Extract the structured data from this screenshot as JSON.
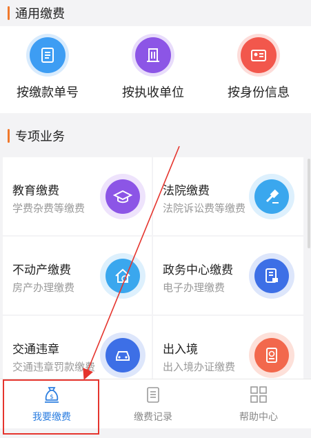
{
  "general_section": {
    "title": "通用缴费",
    "items": [
      {
        "label": "按缴款单号",
        "icon": "receipt-icon",
        "color": "#3d9df3"
      },
      {
        "label": "按执收单位",
        "icon": "building-icon",
        "color": "#8c55e6"
      },
      {
        "label": "按身份信息",
        "icon": "id-card-icon",
        "color": "#f2574c"
      }
    ]
  },
  "special_section": {
    "title": "专项业务",
    "items": [
      {
        "title": "教育缴费",
        "subtitle": "学费杂费等缴费",
        "icon": "graduation-cap-icon",
        "color": "#8c55e6"
      },
      {
        "title": "法院缴费",
        "subtitle": "法院诉讼费等缴费",
        "icon": "gavel-icon",
        "color": "#3aa7ee"
      },
      {
        "title": "不动产缴费",
        "subtitle": "房产办理缴费",
        "icon": "house-icon",
        "color": "#3aa7ee"
      },
      {
        "title": "政务中心缴费",
        "subtitle": "电子办理缴费",
        "icon": "document-icon",
        "color": "#3d6fe6"
      },
      {
        "title": "交通违章",
        "subtitle": "交通违章罚款缴费",
        "icon": "car-icon",
        "color": "#3d6fe6"
      },
      {
        "title": "出入境",
        "subtitle": "出入境办证缴费",
        "icon": "passport-icon",
        "color": "#f2684c"
      }
    ]
  },
  "bottom_nav": {
    "items": [
      {
        "label": "我要缴费",
        "icon": "money-bag-icon",
        "active": true
      },
      {
        "label": "缴费记录",
        "icon": "record-list-icon",
        "active": false
      },
      {
        "label": "帮助中心",
        "icon": "grid-icon",
        "active": false
      }
    ]
  },
  "colors": {
    "accent": "#f0782b",
    "active_nav": "#2c7ee0",
    "highlight": "#e5342d"
  }
}
